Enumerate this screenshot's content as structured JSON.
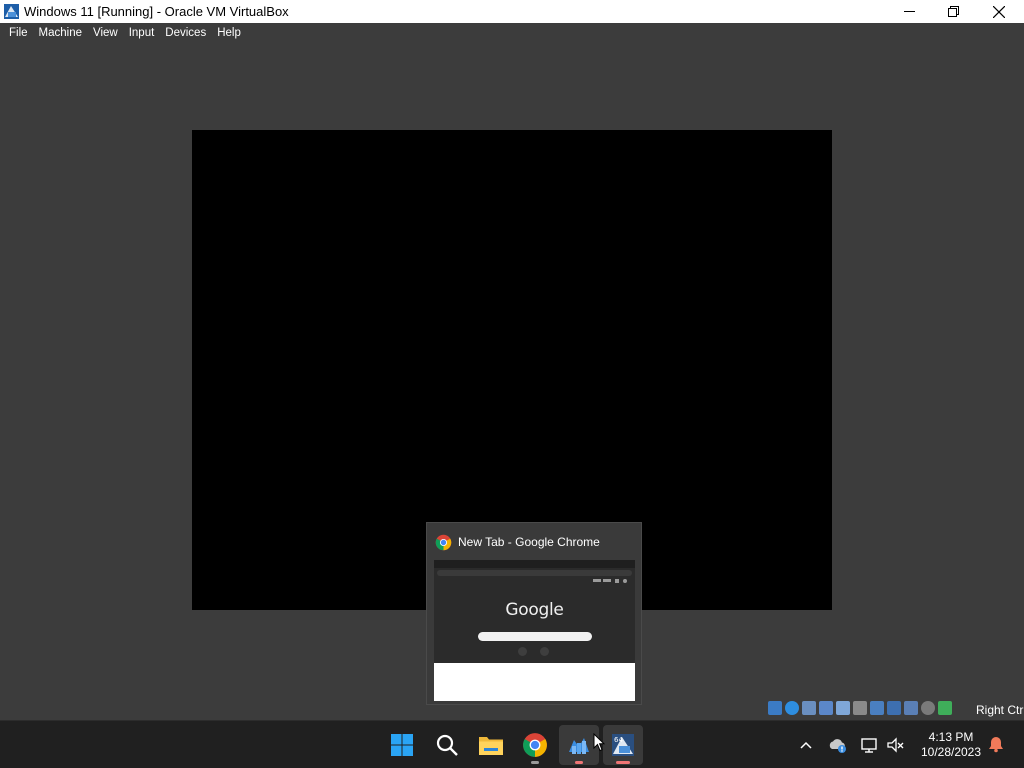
{
  "window": {
    "title": "Windows 11 [Running] - Oracle VM VirtualBox",
    "minimize_icon": "minimize-icon",
    "maximize_icon": "maximize-icon",
    "close_icon": "close-icon"
  },
  "menu": {
    "items": [
      "File",
      "Machine",
      "View",
      "Input",
      "Devices",
      "Help"
    ]
  },
  "preview": {
    "title": "New Tab - Google Chrome",
    "logo_text": "Google"
  },
  "statusbar": {
    "host_key": "Right Ctrl",
    "icons": [
      "hard-disk-icon",
      "optical-drive-icon",
      "audio-icon",
      "network-icon",
      "usb-icon",
      "shared-folders-icon",
      "display-icon",
      "video-capture-icon",
      "cpu-icon",
      "mouse-integration-icon",
      "keyboard-icon"
    ]
  },
  "taskbar": {
    "apps": [
      "start-icon",
      "search-icon",
      "file-explorer-icon",
      "chrome-icon",
      "virtualbox-manager-icon",
      "virtualbox-vm-icon"
    ]
  },
  "tray": {
    "time": "4:13 PM",
    "date": "10/28/2023"
  },
  "colors": {
    "background": "#3c3c3c",
    "taskbar": "#202020",
    "accent": "#f07575"
  }
}
